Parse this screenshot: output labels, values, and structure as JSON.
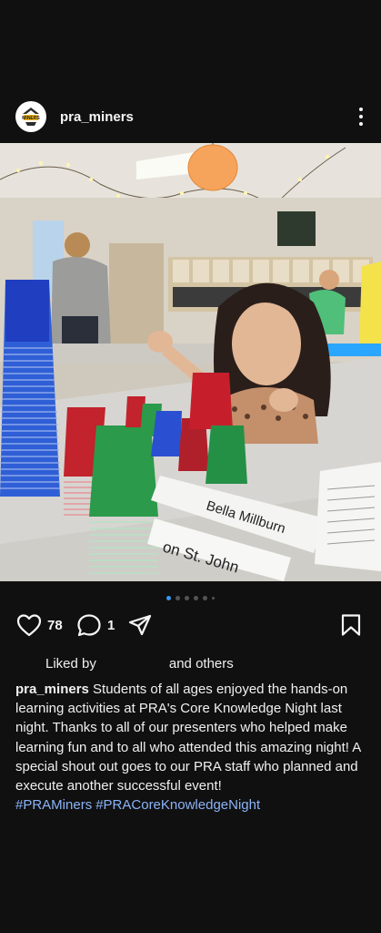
{
  "post": {
    "username": "pra_miners",
    "avatar_text": "MINERS",
    "like_count": "78",
    "comment_count": "1",
    "liked_by_prefix": "Liked by",
    "liked_by_suffix": "and others",
    "caption_user": "pra_miners",
    "caption_text": "Students of all ages enjoyed the hands-on learning activities at PRA's Core Knowledge Night last night. Thanks to all of our presenters who helped make learning fun and to all who attended this amazing night! A special shout out goes to our PRA staff who planned  and execute another successful event!",
    "hashtags": [
      "#PRAMiners",
      "#PRACoreKnowledgeNight"
    ],
    "carousel": {
      "total": 6,
      "active_index": 0
    }
  },
  "photo": {
    "name_card_1": "Bella Millburn",
    "name_card_2": "on St. John"
  },
  "icons": {
    "more": "more-vertical-icon",
    "like": "heart-icon",
    "comment": "comment-icon",
    "share": "send-icon",
    "save": "bookmark-icon"
  },
  "colors": {
    "background": "#101010",
    "hashtag": "#8ab4f8",
    "carousel_active": "#3897f0"
  }
}
